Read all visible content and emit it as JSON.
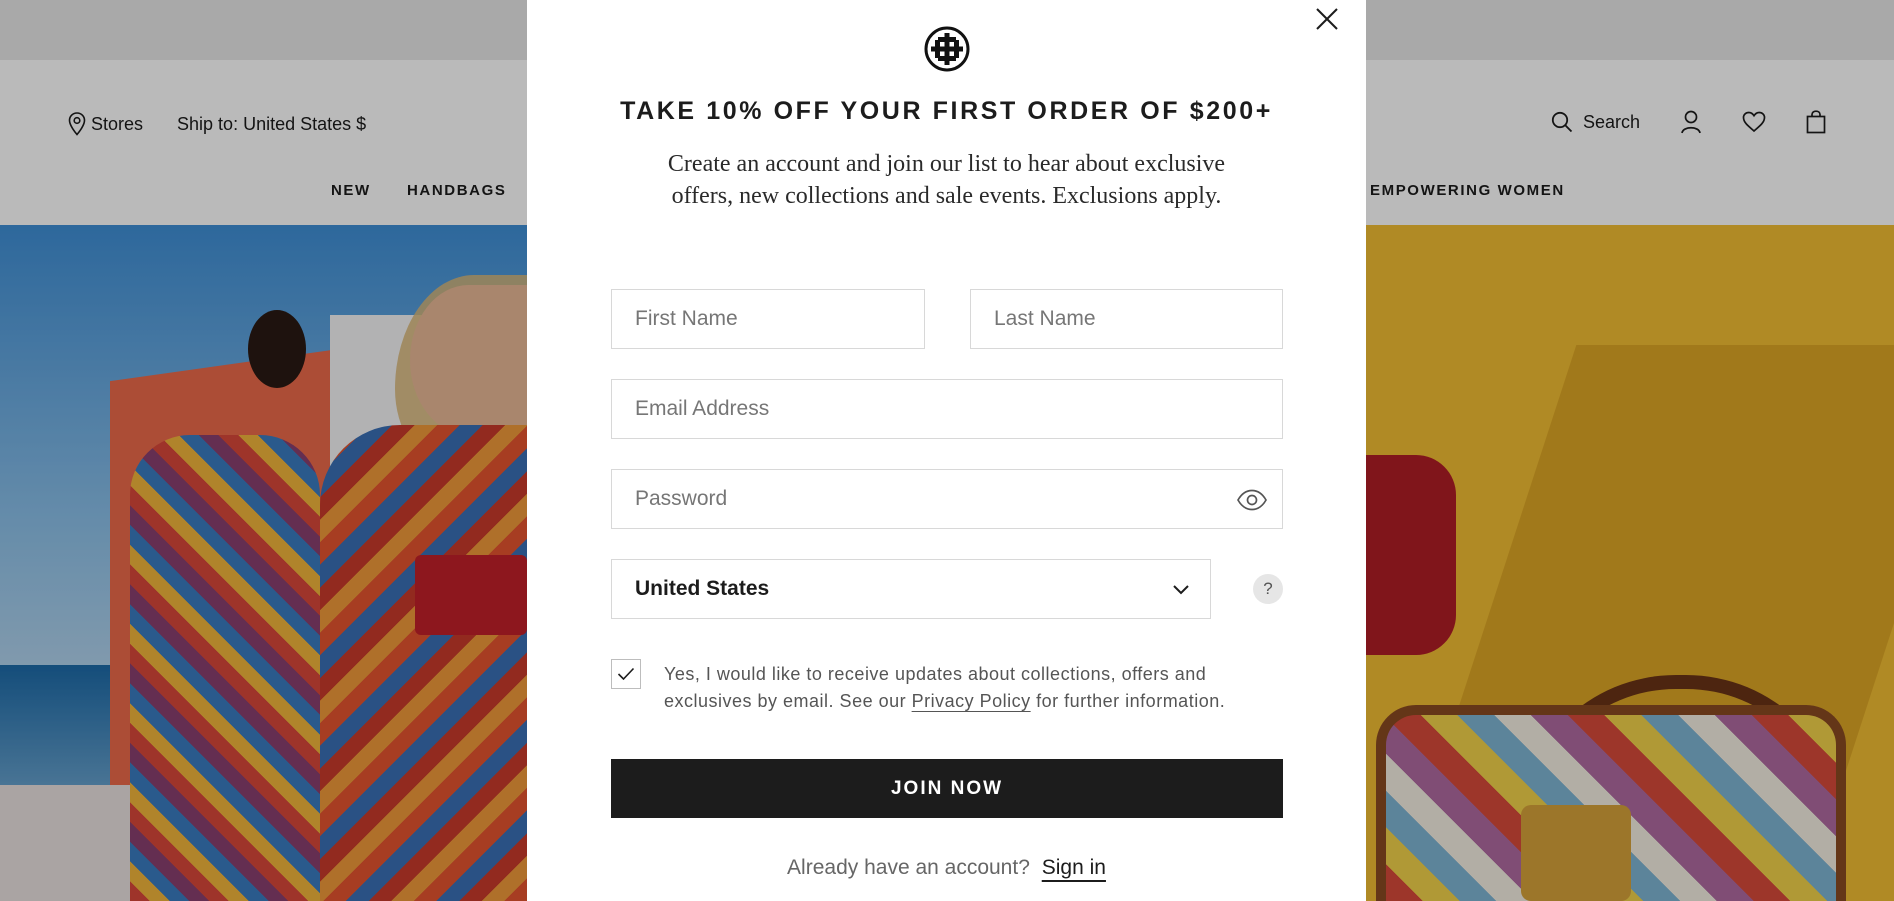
{
  "header": {
    "stores_label": "Stores",
    "ship_to_label": "Ship to: United States $",
    "search_label": "Search",
    "nav": [
      {
        "label": "NEW"
      },
      {
        "label": "HANDBAGS"
      },
      {
        "label": "EMPOWERING WOMEN"
      }
    ],
    "icons": [
      "location-pin-icon",
      "search-icon",
      "account-icon",
      "heart-icon",
      "shopping-bag-icon"
    ]
  },
  "modal": {
    "title": "TAKE 10% OFF YOUR FIRST ORDER OF $200+",
    "subtitle": "Create an account and join our list to hear about exclusive offers, new collections and sale events. Exclusions apply.",
    "fields": {
      "first_name": {
        "placeholder": "First Name",
        "value": ""
      },
      "last_name": {
        "placeholder": "Last Name",
        "value": ""
      },
      "email": {
        "placeholder": "Email Address",
        "value": ""
      },
      "password": {
        "placeholder": "Password",
        "value": ""
      },
      "country": {
        "value": "United States"
      }
    },
    "help_label": "?",
    "consent": {
      "checked": true,
      "text_before": "Yes, I would like to receive updates about collections, offers and exclusives by email. See our ",
      "link_label": "Privacy Policy",
      "text_after": " for further information."
    },
    "join_button_label": "JOIN NOW",
    "signin_prompt": "Already have an account?",
    "signin_link_label": "Sign in"
  },
  "colors": {
    "primary_button": "#1c1c1c",
    "overlay": "rgba(0,0,0,0.27)",
    "hero_right_background": "#f2bd33"
  }
}
